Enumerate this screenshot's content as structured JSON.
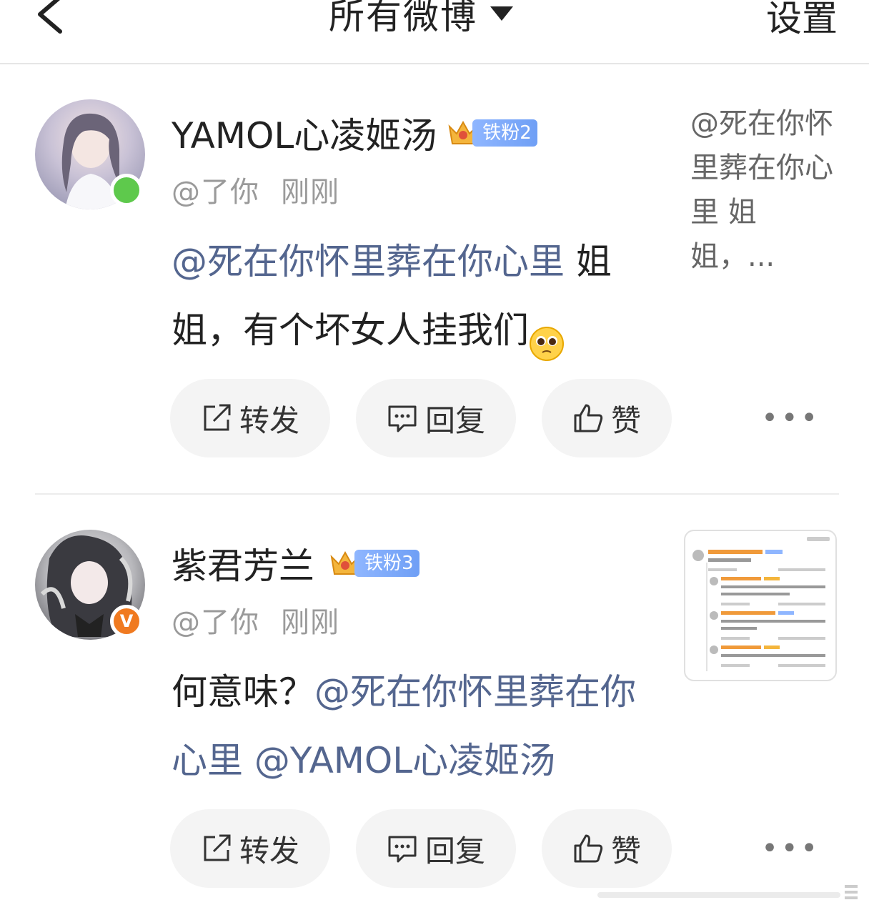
{
  "header": {
    "title": "所有微博",
    "settings_label": "设置"
  },
  "comments": [
    {
      "name": "YAMOL心凌姬汤",
      "fan_badge": "铁粉2",
      "reply_to": "@了你",
      "time": "刚刚",
      "mention": "@死在你怀里葬在你心里",
      "text": " 姐姐，有个坏女人挂我们",
      "preview": "@死在你怀里葬在你心里 姐姐，...",
      "status_color": "#5ec94c"
    },
    {
      "name": "紫君芳兰",
      "fan_badge": "铁粉3",
      "reply_to": "@了你",
      "time": "刚刚",
      "text_prefix": "何意味？",
      "mention1": "@死在你怀里葬在你心里",
      "mention2": "@YAMOL心凌姬汤",
      "verified_color": "#f07a20",
      "verified_label": "V"
    }
  ],
  "actions": {
    "repost": "转发",
    "reply": "回复",
    "like": "赞"
  },
  "more_label": "•••",
  "accent": {
    "mention": "#54668f",
    "fan_badge": "#7ba6f7"
  },
  "icons": [
    "back-icon",
    "dropdown-caret-icon",
    "repost-icon",
    "comment-icon",
    "like-icon",
    "more-icon",
    "crown-icon"
  ]
}
